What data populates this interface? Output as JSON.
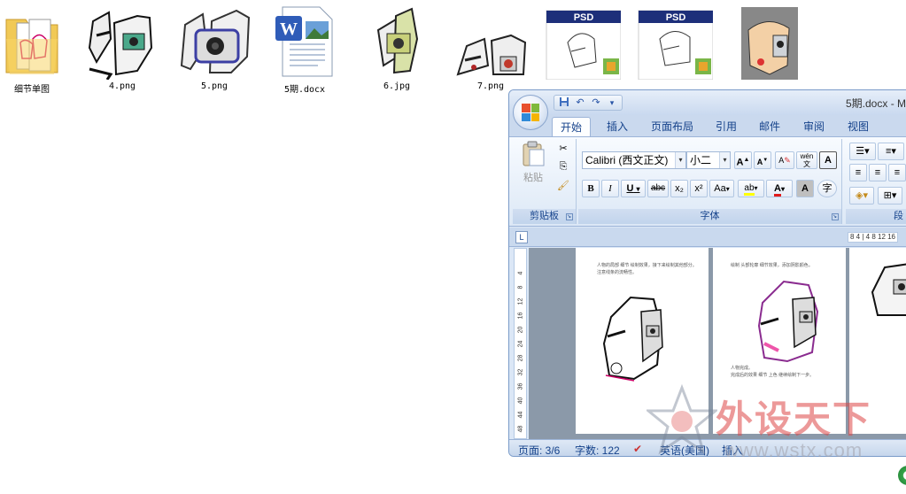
{
  "desktop": {
    "files": [
      {
        "name": "细节单图",
        "type": "folder"
      },
      {
        "name": "4.png",
        "type": "image"
      },
      {
        "name": "5.png",
        "type": "image"
      },
      {
        "name": "5期.docx",
        "type": "word"
      },
      {
        "name": "6.jpg",
        "type": "image"
      },
      {
        "name": "7.png",
        "type": "image"
      },
      {
        "name": "",
        "type": "psd",
        "badge": "PSD"
      },
      {
        "name": "",
        "type": "psd",
        "badge": "PSD"
      },
      {
        "name": "",
        "type": "image"
      }
    ]
  },
  "word": {
    "title": "5期.docx - M",
    "qat": {
      "save": "💾",
      "undo": "↶",
      "redo": "↷",
      "more": "▾"
    },
    "tabs": [
      "开始",
      "插入",
      "页面布局",
      "引用",
      "邮件",
      "审阅",
      "视图"
    ],
    "ribbon": {
      "clipboard": {
        "paste": "粘贴",
        "label": "剪贴板"
      },
      "font": {
        "name": "Calibri (西文正文)",
        "size": "小二",
        "label": "字体",
        "grow": "A",
        "shrink": "A",
        "clear": "A",
        "wen": "wén",
        "boxA": "A",
        "bold": "B",
        "italic": "I",
        "underline": "U",
        "strike": "abc",
        "sub": "x₂",
        "sup": "x²",
        "case": "Aa",
        "highlight": "ab",
        "color": "A",
        "shade": "A",
        "enclose": "字"
      },
      "paragraph": {
        "label": "段"
      }
    },
    "ruler": {
      "toggle": "L",
      "marks": "8 4 | 4 8 12 16"
    },
    "vruler_marks": [
      "4",
      "8",
      "12",
      "16",
      "20",
      "24",
      "28",
      "32",
      "36",
      "40",
      "44",
      "48"
    ],
    "pages": [
      {
        "text": [
          "人物的局部 细节 绘制效果，接下来绘制其他部分。",
          "注意线条的流畅性。"
        ]
      },
      {
        "text": [
          "绘制 头部轮廓 细节效果，添加阴影颜色。",
          "人物完成。",
          "完成后的效果 细节 上色 继续绘制下一步。"
        ]
      },
      {
        "text": []
      }
    ],
    "status": {
      "page": "页面: 3/6",
      "words": "字数: 122",
      "lang": "英语(美国)",
      "insert": "插入"
    }
  },
  "watermark": {
    "text": "外设天下",
    "url": "www.wstx.com"
  }
}
